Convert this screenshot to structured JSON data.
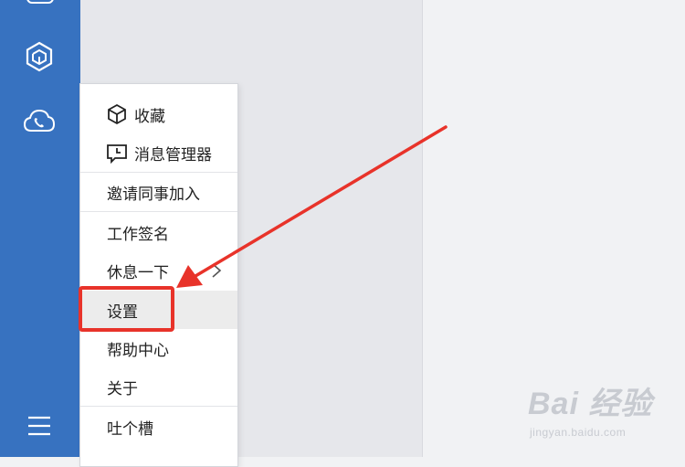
{
  "sidebar": {
    "icons": [
      "window-icon",
      "cube-icon",
      "phone-cloud-icon",
      "hamburger-menu-icon"
    ]
  },
  "menu": {
    "items": [
      {
        "label": "收藏",
        "icon": "cube-outline-icon"
      },
      {
        "label": "消息管理器",
        "icon": "message-clock-icon"
      },
      {
        "label": "邀请同事加入"
      },
      {
        "label": "工作签名"
      },
      {
        "label": "休息一下",
        "submenu_indicator": "›"
      },
      {
        "label": "设置",
        "highlighted": true
      },
      {
        "label": "帮助中心"
      },
      {
        "label": "关于"
      },
      {
        "label": "吐个槽"
      }
    ]
  },
  "annotation": {
    "highlight_color": "#e8332a"
  },
  "watermark": {
    "logo": "Bai 经验",
    "url": "jingyan.baidu.com"
  },
  "colors": {
    "sidebar": "#3772c0",
    "menu_bg": "#ffffff",
    "highlight_row": "#ececec"
  }
}
